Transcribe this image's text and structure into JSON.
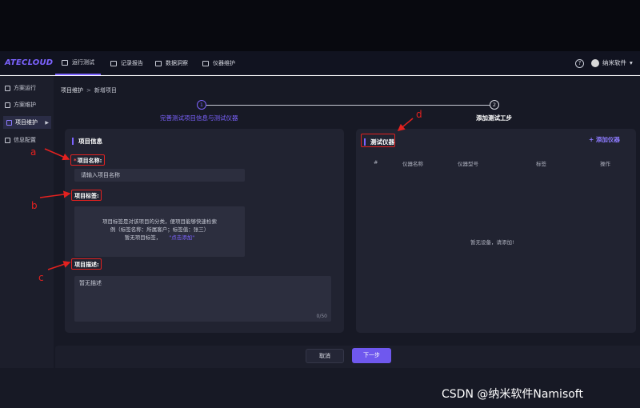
{
  "app": {
    "logo": "ATECLOUD"
  },
  "nav": {
    "tabs": [
      {
        "label": "运行测试",
        "icon": "monitor-icon",
        "active": true
      },
      {
        "label": "记录报告",
        "icon": "report-icon",
        "active": false
      },
      {
        "label": "数据洞察",
        "icon": "chart-icon",
        "active": false
      },
      {
        "label": "仪器维护",
        "icon": "instrument-icon",
        "active": false
      }
    ],
    "help_icon": "?",
    "user_name": "纳米软件",
    "user_caret": "▾"
  },
  "sidebar": {
    "items": [
      {
        "label": "方案运行",
        "icon": "run-icon",
        "active": false
      },
      {
        "label": "方案维护",
        "icon": "edit-icon",
        "active": false
      },
      {
        "label": "项目维护",
        "icon": "layers-icon",
        "active": true
      },
      {
        "label": "信息配置",
        "icon": "sliders-icon",
        "active": false
      }
    ],
    "active_arrow": "▶"
  },
  "breadcrumb": {
    "root": "项目维护",
    "separator": ">",
    "current": "新增项目"
  },
  "steps": [
    {
      "number": "1",
      "label": "完善测试项目信息与测试仪器",
      "status": "active"
    },
    {
      "number": "2",
      "label": "添加测试工步",
      "status": "pending"
    }
  ],
  "project_info": {
    "title": "项目信息",
    "name_label": "项目名称:",
    "name_required_mark": "*",
    "name_placeholder": "请输入项目名称",
    "tags_label": "项目标签:",
    "tags_help_line1": "项目标签是对该项目的分类，便项目能够快速检索",
    "tags_help_line2": "例（标签名称：所属客户；标签值：张三）",
    "tags_empty": "暂无项目标签，",
    "tags_add_link": "\"点击添加\"",
    "desc_label": "项目描述:",
    "desc_value": "暂无描述",
    "desc_counter": "0/50"
  },
  "instruments": {
    "title": "测试仪器",
    "add_label": "+ 添加仪器",
    "columns": [
      "#",
      "仪器名称",
      "仪器型号",
      "标签",
      "操作"
    ],
    "empty_message": "暂无设备，请添加!"
  },
  "footer": {
    "cancel_label": "取消",
    "next_label": "下一步"
  },
  "annotations": {
    "a": "a",
    "b": "b",
    "c": "c",
    "d": "d"
  },
  "watermark": "CSDN @纳米软件Namisoft",
  "colors": {
    "accent": "#7c63ff",
    "annotation": "#e3211f",
    "background": "#171925",
    "panel": "#212331"
  }
}
